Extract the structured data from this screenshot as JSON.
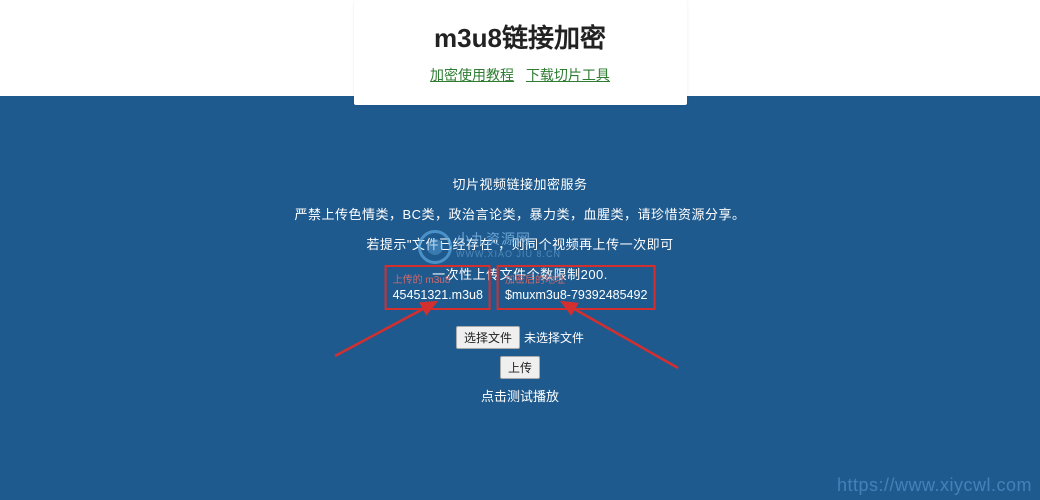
{
  "header": {
    "title": "m3u8链接加密",
    "link1": "加密使用教程",
    "link2": "下载切片工具"
  },
  "section": {
    "line1": "切片视频链接加密服务",
    "line2": "严禁上传色情类，BC类，政治言论类，暴力类，血腥类，请珍惜资源分享。",
    "line3": "若提示\"文件已经存在\"，则同个视频再上传一次即可",
    "line4": "一次性上传文件个数限制200."
  },
  "result": {
    "left_label": "上传的 m3u8",
    "left_value": "45451321.m3u8",
    "right_label": "加密后的地址",
    "right_value": "$muxm3u8-79392485492"
  },
  "file": {
    "button": "选择文件",
    "status": "未选择文件",
    "upload": "上传"
  },
  "test_link": "点击测试播放",
  "watermark": {
    "main": "小九资源网",
    "sub": "WWW.XIAO JIU 8.CN",
    "url": "https://www.xiycwl.com"
  }
}
